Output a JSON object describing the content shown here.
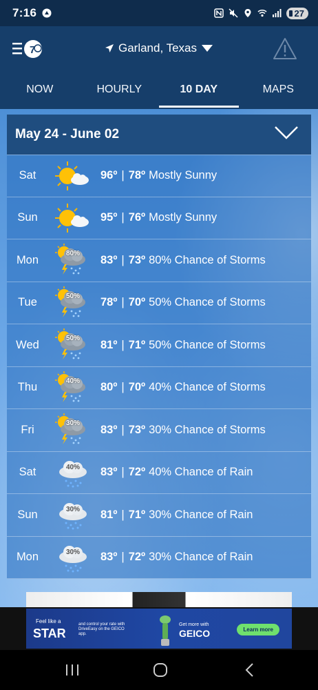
{
  "status_bar": {
    "time": "7:16",
    "battery": "27"
  },
  "header": {
    "location": "Garland, Texas"
  },
  "tabs": [
    {
      "label": "NOW",
      "active": false
    },
    {
      "label": "HOURLY",
      "active": false
    },
    {
      "label": "10 DAY",
      "active": true
    },
    {
      "label": "MAPS",
      "active": false
    }
  ],
  "range": {
    "label": "May 24 - June 02"
  },
  "days": [
    {
      "day": "Sat",
      "icon": "sun-cloud-icon",
      "hi": "96º",
      "lo": "78º",
      "condition": "Mostly Sunny"
    },
    {
      "day": "Sun",
      "icon": "sun-cloud-icon",
      "hi": "95º",
      "lo": "76º",
      "condition": "Mostly Sunny"
    },
    {
      "day": "Mon",
      "icon": "sun-storm-icon",
      "pct": "80%",
      "hi": "83º",
      "lo": "73º",
      "condition": "80% Chance of Storms"
    },
    {
      "day": "Tue",
      "icon": "sun-storm-icon",
      "pct": "50%",
      "hi": "78º",
      "lo": "70º",
      "condition": "50% Chance of Storms"
    },
    {
      "day": "Wed",
      "icon": "sun-storm-icon",
      "pct": "50%",
      "hi": "81º",
      "lo": "71º",
      "condition": "50% Chance of Storms"
    },
    {
      "day": "Thu",
      "icon": "sun-storm-icon",
      "pct": "40%",
      "hi": "80º",
      "lo": "70º",
      "condition": "40% Chance of Storms"
    },
    {
      "day": "Fri",
      "icon": "sun-storm-icon",
      "pct": "30%",
      "hi": "83º",
      "lo": "73º",
      "condition": "30% Chance of Storms"
    },
    {
      "day": "Sat",
      "icon": "rain-cloud-icon",
      "pct": "40%",
      "hi": "83º",
      "lo": "72º",
      "condition": "40% Chance of Rain"
    },
    {
      "day": "Sun",
      "icon": "rain-cloud-icon",
      "pct": "30%",
      "hi": "81º",
      "lo": "71º",
      "condition": "30% Chance of Rain"
    },
    {
      "day": "Mon",
      "icon": "rain-cloud-icon",
      "pct": "30%",
      "hi": "83º",
      "lo": "72º",
      "condition": "30% Chance of Rain"
    }
  ],
  "ad": {
    "feel": "Feel like a",
    "star": "STAR",
    "blurb1": "and control your rate with DriveEasy on the GEICO app.",
    "blurb2": "Get more with",
    "brand": "GEICO",
    "cta": "Learn more"
  },
  "colors": {
    "header_bg": "#163e6a",
    "status_bg": "#0f2c4c",
    "range_bg": "#1f4d7f",
    "ad_cta": "#6fe06d"
  }
}
